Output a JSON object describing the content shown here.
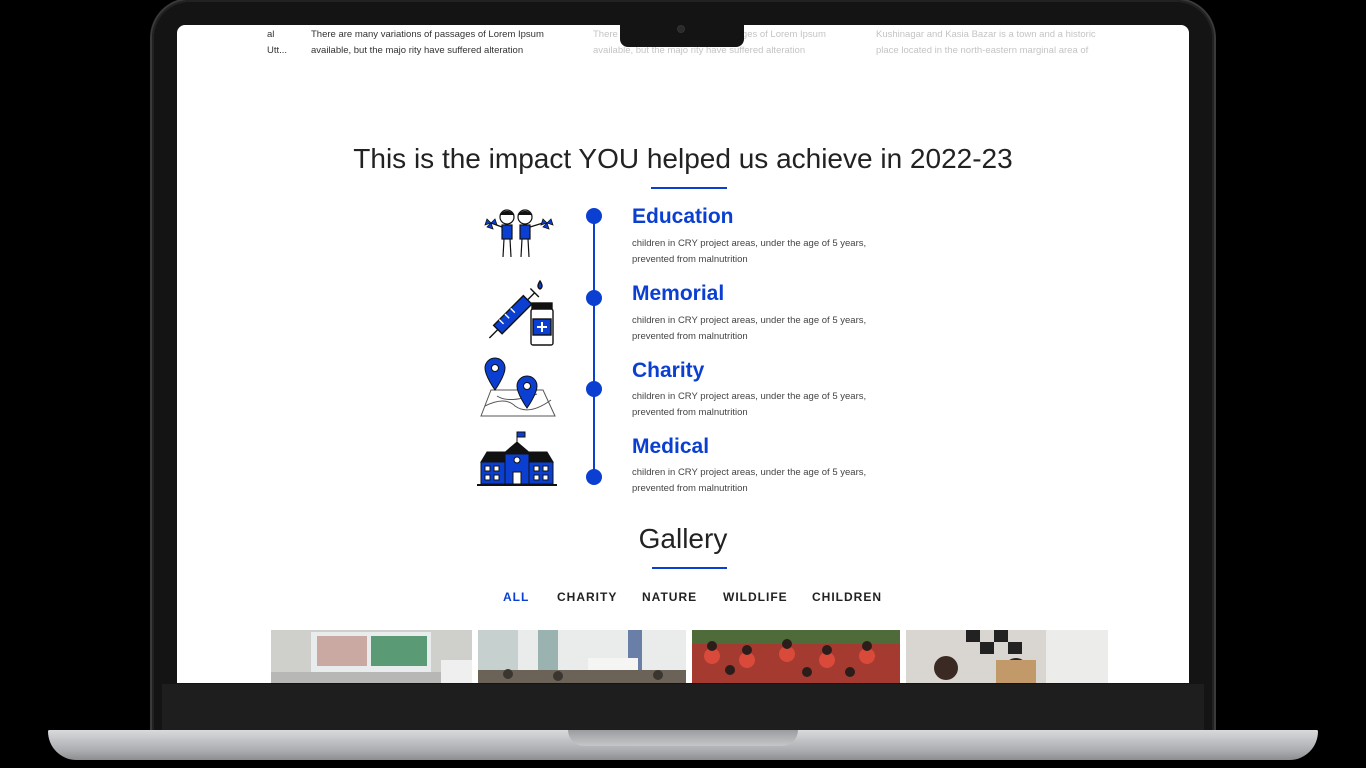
{
  "top_strip": {
    "items": [
      {
        "line1": "al",
        "line2": "Utt..."
      },
      {
        "line1": "There are many variations of passages of Lorem Ipsum",
        "line2": "available, but the majo rity have suffered alteration"
      },
      {
        "line1": "There are many variations of passages of Lorem Ipsum",
        "line2": "available, but the majo rity have suffered alteration"
      },
      {
        "line1": "Kushinagar and Kasia Bazar is a town and a historic",
        "line2": "place located in the north-eastern marginal area of"
      }
    ]
  },
  "impact": {
    "title": "This is the impact YOU helped us achieve in 2022-23",
    "accent_color": "#0a3fd1",
    "items": [
      {
        "heading": "Education",
        "desc_line1": "children in CRY project areas, under the age of 5 years,",
        "desc_line2": "prevented from malnutrition",
        "icon": "children-icon"
      },
      {
        "heading": "Memorial",
        "desc_line1": "children in CRY project areas, under the age of 5 years,",
        "desc_line2": "prevented from malnutrition",
        "icon": "vaccine-icon"
      },
      {
        "heading": "Charity",
        "desc_line1": "children in CRY project areas, under the age of 5 years,",
        "desc_line2": "prevented from malnutrition",
        "icon": "map-pin-icon"
      },
      {
        "heading": "Medical",
        "desc_line1": "children in CRY project areas, under the age of 5 years,",
        "desc_line2": "prevented from malnutrition",
        "icon": "school-icon"
      }
    ]
  },
  "gallery": {
    "title": "Gallery",
    "filters": [
      {
        "label": "ALL",
        "active": true
      },
      {
        "label": "CHARITY",
        "active": false
      },
      {
        "label": "NATURE",
        "active": false
      },
      {
        "label": "WILDLIFE",
        "active": false
      },
      {
        "label": "CHILDREN",
        "active": false
      }
    ]
  }
}
